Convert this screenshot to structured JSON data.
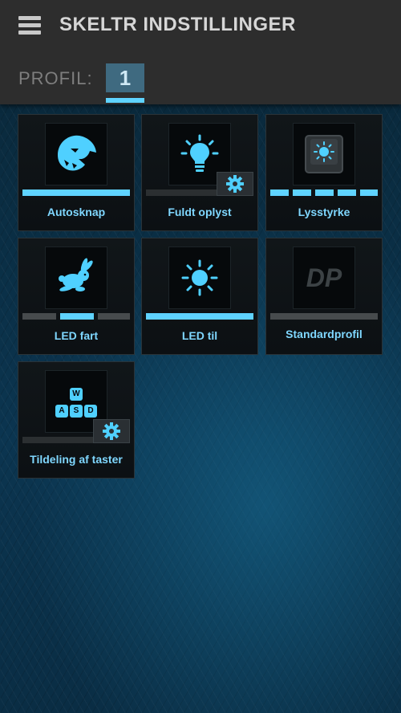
{
  "header": {
    "title": "SKELTR INDSTILLINGER",
    "profile_label": "PROFIL:",
    "profile_tab": "1"
  },
  "colors": {
    "accent": "#5fd3ff",
    "header_bg": "#2d2d2d",
    "tile_bg": "#111619"
  },
  "tiles": [
    {
      "label": "Autosknap",
      "icon": "roccat-panther-icon",
      "level": 1.0
    },
    {
      "label": "Fuldt oplyst",
      "icon": "lightbulb-icon",
      "level": 0.0,
      "has_settings": true
    },
    {
      "label": "Lysstyrke",
      "icon": "brightness-key-icon",
      "level_segments": 5,
      "level_segments_active": 5
    },
    {
      "label": "LED fart",
      "icon": "rabbit-icon",
      "level_segments": 3,
      "level_segments_active_index": 1
    },
    {
      "label": "LED til",
      "icon": "sun-icon",
      "level": 1.0
    },
    {
      "label": "Standardprofil",
      "icon": "dp-logo-icon",
      "icon_text": "DP",
      "level": 0.0
    },
    {
      "label": "Tildeling af taster",
      "icon": "wasd-keys-icon",
      "keys": [
        "W",
        "A",
        "S",
        "D"
      ],
      "level": 0.0,
      "has_settings": true
    }
  ]
}
